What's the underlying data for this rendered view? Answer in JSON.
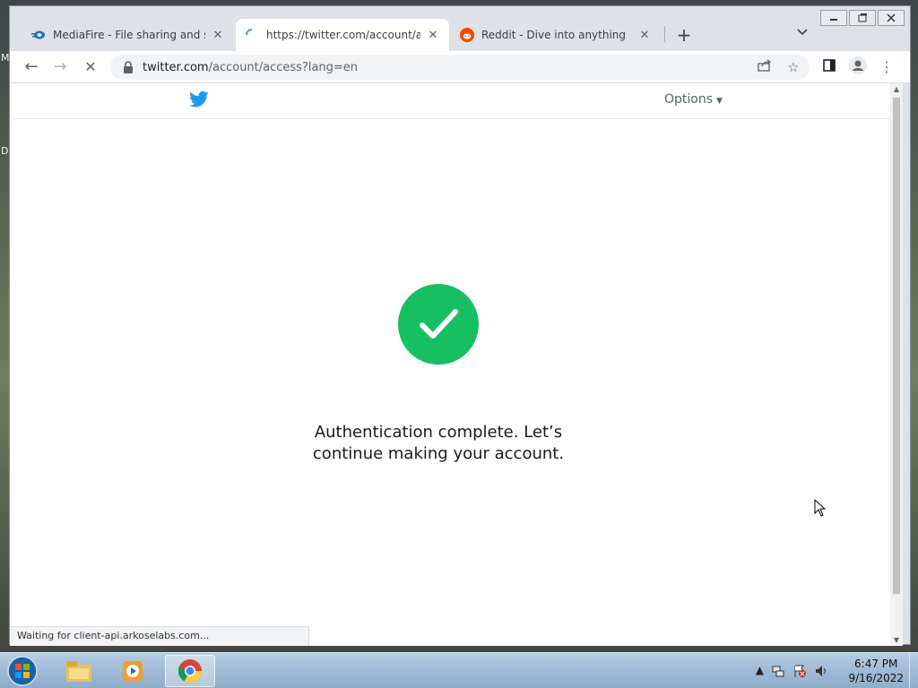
{
  "desktop": {
    "side_letters": [
      "M",
      "D"
    ]
  },
  "window": {
    "controls": [
      "minimize",
      "restore",
      "close"
    ],
    "tabs": [
      {
        "title": "MediaFire - File sharing and stora",
        "icon": "mediafire-icon"
      },
      {
        "title": "https://twitter.com/account/acce",
        "icon": "loading-spinner-icon",
        "active": true
      },
      {
        "title": "Reddit - Dive into anything",
        "icon": "reddit-icon"
      }
    ],
    "new_tab_label": "+",
    "tab_search_label": "⌄"
  },
  "toolbar": {
    "back_icon": "←",
    "forward_icon": "→",
    "stop_icon": "✕",
    "url_host": "twitter.com",
    "url_path": "/account/access?lang=en"
  },
  "page": {
    "options_label": "Options",
    "message_line1": "Authentication complete. Let’s",
    "message_line2": "continue making your account.",
    "colors": {
      "success": "#17bf63",
      "twitter_blue": "#1d9bf0"
    }
  },
  "status_bar": {
    "text": "Waiting for client-api.arkoselabs.com..."
  },
  "taskbar": {
    "apps": [
      "windows-explorer",
      "media-player",
      "chrome"
    ],
    "clock_time": "6:47 PM",
    "clock_date": "9/16/2022"
  }
}
